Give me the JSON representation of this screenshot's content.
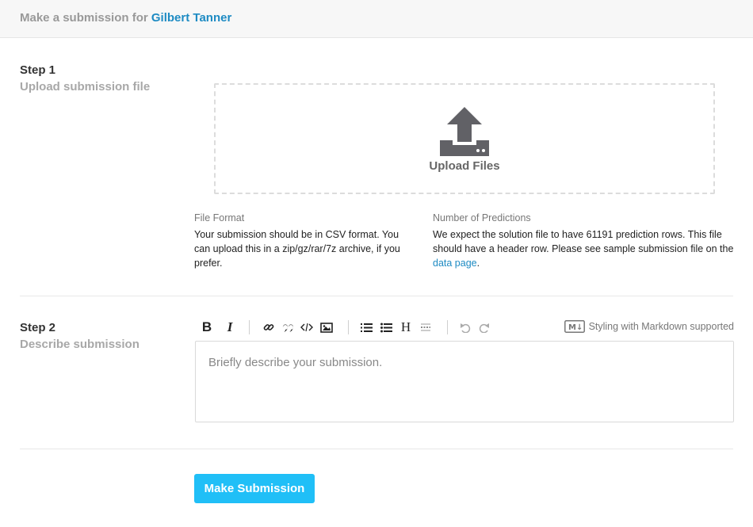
{
  "header": {
    "prefix": "Make a submission for",
    "user": "Gilbert Tanner"
  },
  "step1": {
    "number": "Step 1",
    "title": "Upload submission file",
    "dropzone": {
      "icon": "upload-icon",
      "label": "Upload Files"
    },
    "file_format": {
      "title": "File Format",
      "text": "Your submission should be in CSV format. You can upload this in a zip/gz/rar/7z archive, if you prefer."
    },
    "predictions": {
      "title": "Number of Predictions",
      "text_before": "We expect the solution file to have 61191 prediction rows. This file should have a header row. Please see sample submission file on the",
      "link": "data page",
      "text_after": "."
    }
  },
  "step2": {
    "number": "Step 2",
    "title": "Describe submission",
    "toolbar": {
      "bold": "B",
      "italic": "I",
      "heading": "H",
      "markdown_note": "Styling with Markdown supported",
      "markdown_badge": "M↓"
    },
    "placeholder": "Briefly describe your submission."
  },
  "submit": {
    "label": "Make Submission"
  },
  "colors": {
    "accent": "#20bff7",
    "link": "#1e8bc3"
  }
}
